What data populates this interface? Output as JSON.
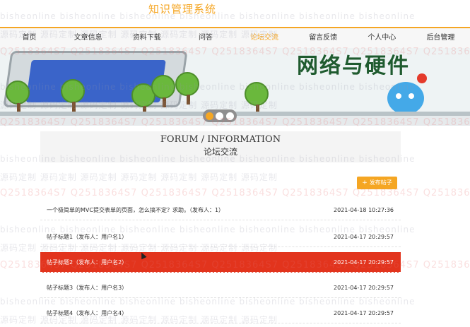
{
  "header": {
    "site_title": "知识管理系统"
  },
  "nav": {
    "items": [
      {
        "label": "首页"
      },
      {
        "label": "文章信息"
      },
      {
        "label": "资料下载"
      },
      {
        "label": "问答"
      },
      {
        "label": "论坛交流",
        "active": true
      },
      {
        "label": "留言反馈"
      },
      {
        "label": "个人中心"
      },
      {
        "label": "后台管理"
      }
    ]
  },
  "banner": {
    "slogan": "网络与硬件",
    "slider_dots": [
      {
        "active": true
      },
      {
        "active": false
      },
      {
        "active": false
      }
    ]
  },
  "section": {
    "title_en": "FORUM / INFORMATION",
    "title_cn": "论坛交流"
  },
  "actions": {
    "post_label": "发布帖子",
    "post_icon": "plus-icon"
  },
  "threads": [
    {
      "title": "一个极简单的MVC提交表单的页面，怎么搞不定？求助。（发布人：1）",
      "time": "2021-04-18 10:27:36",
      "highlight": false
    },
    {
      "title": "帖子标题1（发布人：用户名1）",
      "time": "2021-04-17 20:29:57",
      "highlight": false
    },
    {
      "title": "帖子标题2（发布人：用户名2）",
      "time": "2021-04-17 20:29:57",
      "highlight": true
    },
    {
      "title": "帖子标题3（发布人：用户名3）",
      "time": "2021-04-17 20:29:57",
      "highlight": false
    },
    {
      "title": "帖子标题4（发布人：用户名4）",
      "time": "2021-04-17 20:29:57",
      "highlight": false
    }
  ],
  "watermark": {
    "text_a": "bisheonline",
    "text_b": "源码定制",
    "text_qq": "Q2518364S7"
  },
  "colors": {
    "accent": "#f5a623",
    "highlight": "#e2341d",
    "nav_bg": "#f7f7f7"
  }
}
